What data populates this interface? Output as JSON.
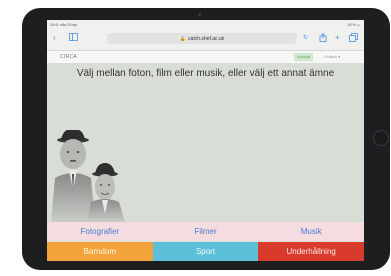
{
  "browser": {
    "status_time": "16:41 mån 29 apr",
    "status_battery": "40 % ▭",
    "url": "catch.shef.ac.uk",
    "icons": [
      "back-icon",
      "sidebar-icon",
      "reload-icon",
      "share-icon",
      "new-tab-icon",
      "tabs-icon"
    ]
  },
  "app": {
    "brand": "CIRCA",
    "language_active": "Avsluta",
    "language_select": "Ordbok ▾"
  },
  "main": {
    "headline": "Välj mellan foton, film eller musik, eller välj ett annat ämne"
  },
  "nav_row1": [
    "Fotografier",
    "Filmer",
    "Musik"
  ],
  "nav_row2": [
    "Barndom",
    "Sport",
    "Underhållning"
  ],
  "colors": {
    "screen_bg": "#d8ddd6",
    "row1_bg": "#f4dce0",
    "barndom": "#f2a33a",
    "sport": "#5bc0d8",
    "underhallning": "#d83a2c"
  }
}
